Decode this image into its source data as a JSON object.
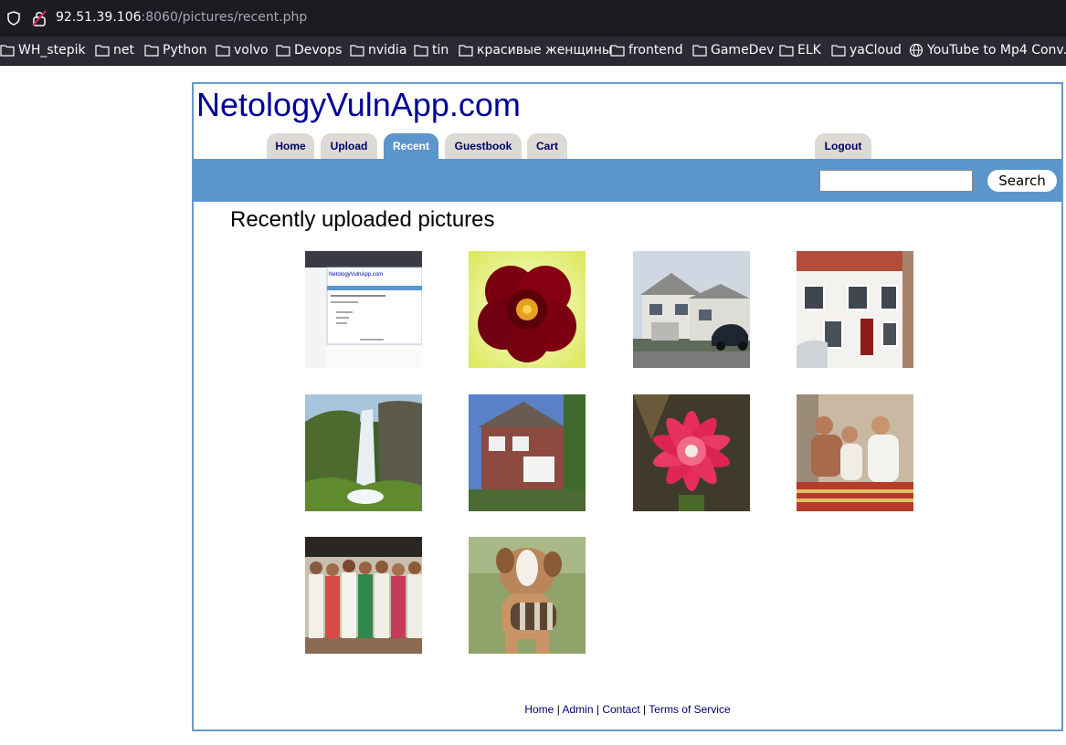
{
  "browser": {
    "url_host": "92.51.39.106",
    "url_rest": ":8060/pictures/recent.php",
    "bookmarks": [
      {
        "label": "WH_stepik",
        "icon": "folder-icon"
      },
      {
        "label": "net",
        "icon": "folder-icon"
      },
      {
        "label": "Python",
        "icon": "folder-icon"
      },
      {
        "label": "volvo",
        "icon": "folder-icon"
      },
      {
        "label": "Devops",
        "icon": "folder-icon"
      },
      {
        "label": "nvidia",
        "icon": "folder-icon"
      },
      {
        "label": "tin",
        "icon": "folder-icon"
      },
      {
        "label": "красивые женщины",
        "icon": "folder-icon"
      },
      {
        "label": "frontend",
        "icon": "folder-icon"
      },
      {
        "label": "GameDev",
        "icon": "folder-icon"
      },
      {
        "label": "ELK",
        "icon": "folder-icon"
      },
      {
        "label": "yaCloud",
        "icon": "folder-icon"
      },
      {
        "label": "YouTube to Mp4 Conv...",
        "icon": "globe-icon"
      }
    ]
  },
  "site": {
    "logo": "NetologyVulnApp.com",
    "nav": [
      {
        "label": "Home",
        "active": false
      },
      {
        "label": "Upload",
        "active": false
      },
      {
        "label": "Recent",
        "active": true
      },
      {
        "label": "Guestbook",
        "active": false
      },
      {
        "label": "Cart",
        "active": false
      }
    ],
    "logout": "Logout",
    "search": {
      "value": "",
      "button": "Search"
    },
    "heading": "Recently uploaded pictures",
    "pictures": [
      {
        "subject": "website-screenshot"
      },
      {
        "subject": "red-flower"
      },
      {
        "subject": "house-with-car"
      },
      {
        "subject": "white-terraced-house"
      },
      {
        "subject": "waterfall"
      },
      {
        "subject": "brick-house"
      },
      {
        "subject": "pink-cactus-flower"
      },
      {
        "subject": "group-on-bed"
      },
      {
        "subject": "group-of-women"
      },
      {
        "subject": "dog-with-barrel"
      }
    ],
    "footer": {
      "links": [
        "Home",
        "Admin",
        "Contact",
        "Terms of Service"
      ],
      "separator": "|"
    }
  },
  "colors": {
    "accent": "#5b95cc",
    "frame_border": "#6699cc",
    "logo": "#000099",
    "tab_inactive": "#ddd9d4"
  }
}
